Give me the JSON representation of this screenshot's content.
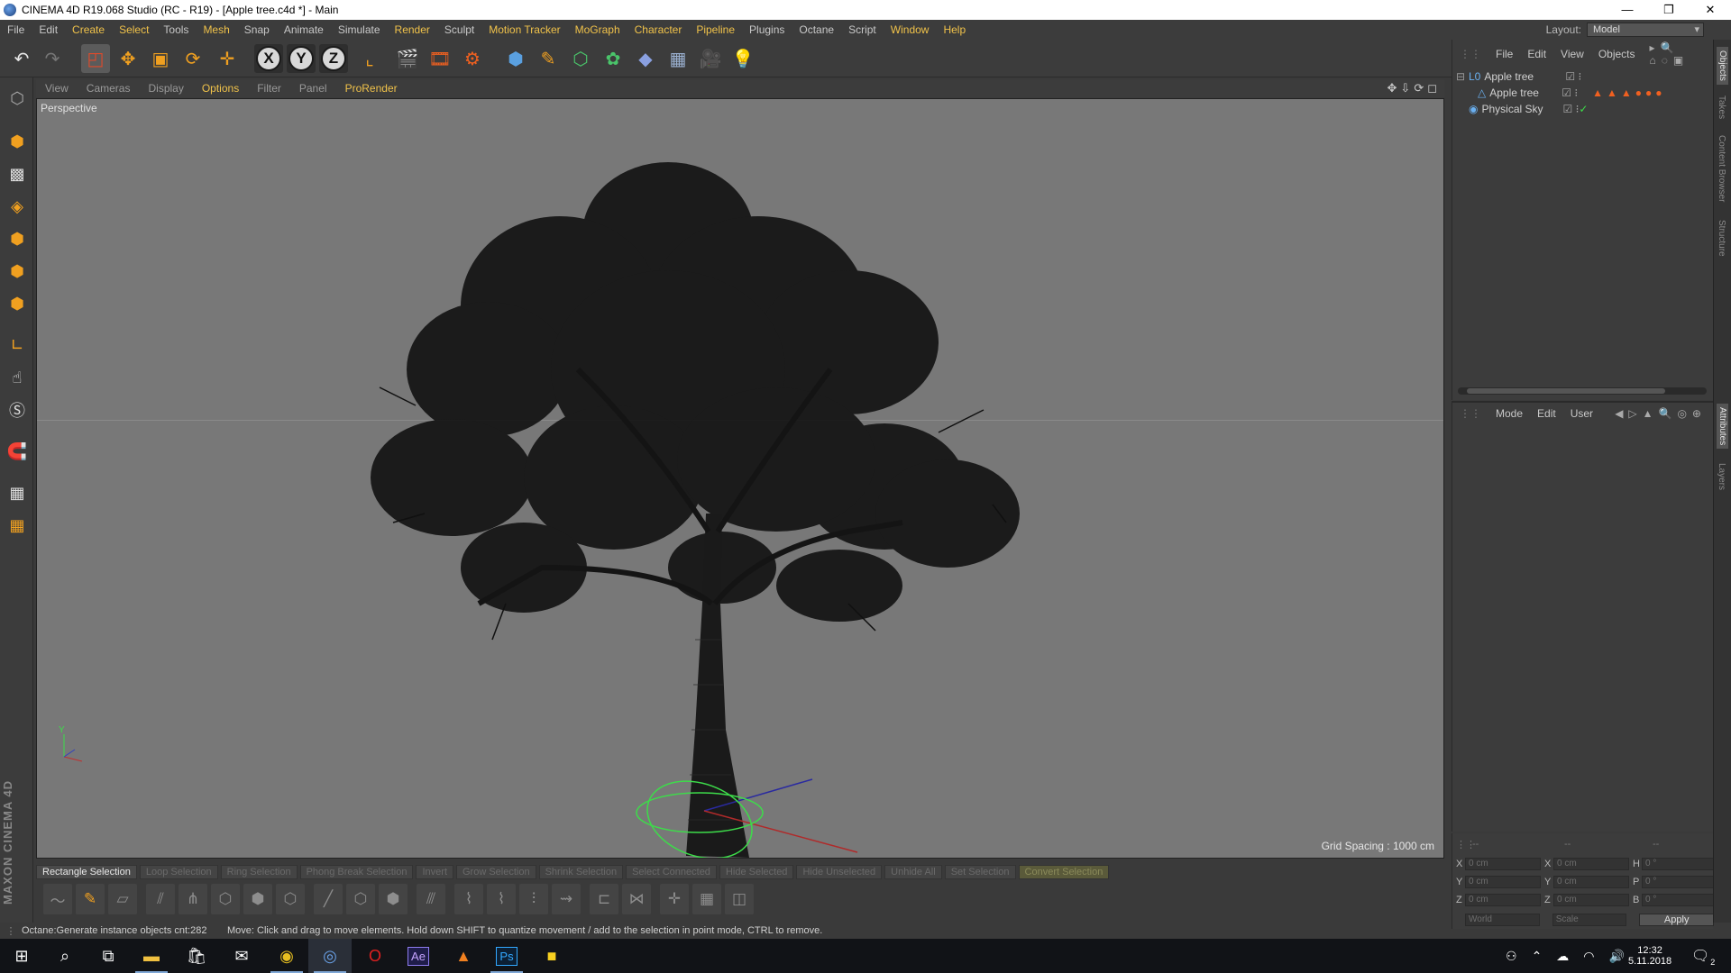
{
  "window": {
    "title": "CINEMA 4D R19.068 Studio (RC - R19) - [Apple tree.c4d *] - Main",
    "minimize": "—",
    "restore": "❐",
    "close": "✕"
  },
  "menu": {
    "items": [
      "File",
      "Edit",
      "Create",
      "Select",
      "Tools",
      "Mesh",
      "Snap",
      "Animate",
      "Simulate",
      "Render",
      "Sculpt",
      "Motion Tracker",
      "MoGraph",
      "Character",
      "Pipeline",
      "Plugins",
      "Octane",
      "Script",
      "Window",
      "Help"
    ],
    "layout_label": "Layout:",
    "layout_value": "Model"
  },
  "toolbar": {
    "axis_x": "X",
    "axis_y": "Y",
    "axis_z": "Z"
  },
  "viewport": {
    "menu": [
      "View",
      "Cameras",
      "Display",
      "Options",
      "Filter",
      "Panel",
      "ProRender"
    ],
    "label": "Perspective",
    "grid_spacing": "Grid Spacing : 1000 cm",
    "axis_y": "Y"
  },
  "selection_bar": [
    "Rectangle Selection",
    "Loop Selection",
    "Ring Selection",
    "Phong Break Selection",
    "Invert",
    "Grow Selection",
    "Shrink Selection",
    "Select Connected",
    "Hide Selected",
    "Hide Unselected",
    "Unhide All",
    "Set Selection",
    "Convert Selection"
  ],
  "status": {
    "left": "Octane:Generate instance objects cnt:282",
    "right": "Move: Click and drag to move elements. Hold down SHIFT to quantize movement / add to the selection in point mode, CTRL to remove."
  },
  "objects_panel": {
    "menu": [
      "File",
      "Edit",
      "View",
      "Objects"
    ],
    "rows": [
      {
        "name": "Apple tree",
        "indent": 0
      },
      {
        "name": "Apple tree",
        "indent": 1
      },
      {
        "name": "Physical Sky",
        "indent": 0
      }
    ]
  },
  "attributes_panel": {
    "menu": [
      "Mode",
      "Edit",
      "User"
    ]
  },
  "coordinates": {
    "headers": [
      "--",
      "--",
      "--"
    ],
    "rows": [
      {
        "a": "X",
        "av": "0 cm",
        "b": "X",
        "bv": "0 cm",
        "c": "H",
        "cv": "0 °"
      },
      {
        "a": "Y",
        "av": "0 cm",
        "b": "Y",
        "bv": "0 cm",
        "c": "P",
        "cv": "0 °"
      },
      {
        "a": "Z",
        "av": "0 cm",
        "b": "Z",
        "bv": "0 cm",
        "c": "B",
        "cv": "0 °"
      }
    ],
    "world": "World",
    "scale": "Scale",
    "apply": "Apply"
  },
  "side_tabs": [
    "Objects",
    "Takes",
    "Content Browser",
    "Structure",
    "Attributes",
    "Layers"
  ],
  "brand": "MAXON CINEMA 4D",
  "taskbar": {
    "time": "12:32",
    "date": "5.11.2018",
    "notifications": "2",
    "ae": "Ae",
    "ps": "Ps"
  },
  "colors": {
    "accent": "#f0c24a",
    "viewport_bg": "#787878",
    "panel_bg": "#3c3c3c",
    "selection_ring": "#3ddc4a"
  }
}
